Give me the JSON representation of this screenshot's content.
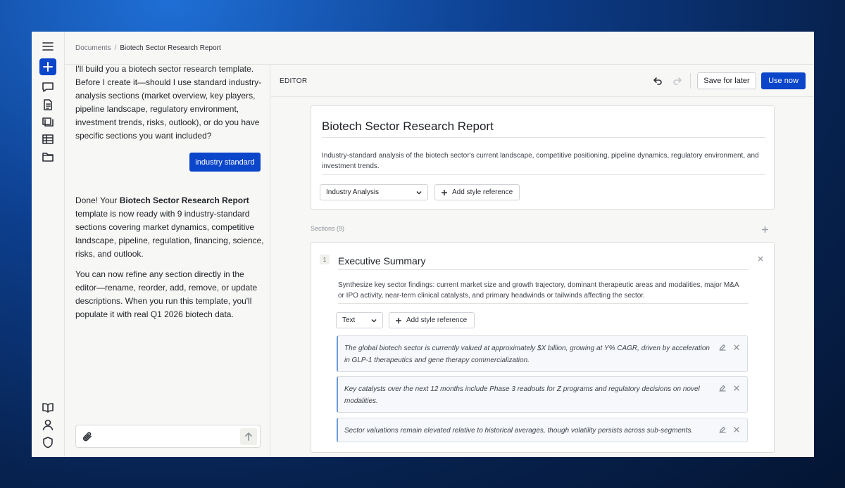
{
  "breadcrumb": {
    "root": "Documents",
    "separator": "/",
    "current": "Biotech Sector Research Report"
  },
  "chat": {
    "assistant_message_lines": [
      "I'll build you a biotech sector research template.",
      "Before I create it—should I use standard industry-",
      "analysis sections (market overview, key players,",
      "pipeline landscape, regulatory environment,",
      "investment trends, risks, outlook), or do you have",
      "specific sections you want included?"
    ],
    "user_reply": "industry standard",
    "done_prefix": "Done! Your ",
    "done_bold": "Biotech Sector Research Report",
    "done_suffix": " template is now ready with 9 industry-standard sections covering market dynamics, competitive landscape, pipeline, regulation, financing, science, risks, and outlook.",
    "followup": "You can now refine any section directly in the editor—rename, reorder, add, remove, or update descriptions. When you run this template, you'll populate it with real Q1 2026 biotech data.",
    "composer_placeholder": ""
  },
  "editor": {
    "label": "EDITOR",
    "save_later": "Save for later",
    "use_now": "Use now",
    "doc_title": "Biotech Sector Research Report",
    "doc_description": "Industry-standard analysis of the biotech sector's current landscape, competitive positioning, pipeline dynamics, regulatory environment, and investment trends.",
    "doc_type": "Industry Analysis",
    "add_style": "Add style reference",
    "sections_label": "Sections (9)",
    "section": {
      "number": "1",
      "title": "Executive Summary",
      "description": "Synthesize key sector findings: current market size and growth trajectory, dominant therapeutic areas and modalities, major M&A or IPO activity, near-term clinical catalysts, and primary headwinds or tailwinds affecting the sector.",
      "format": "Text",
      "add_style": "Add style reference",
      "bullets": [
        "The global biotech sector is currently valued at approximately $X billion, growing at Y% CAGR, driven by acceleration in GLP-1 therapeutics and gene therapy commercialization.",
        "Key catalysts over the next 12 months include Phase 3 readouts for Z programs and regulatory decisions on novel modalities.",
        "Sector valuations remain elevated relative to historical averages, though volatility persists across sub-segments."
      ]
    }
  },
  "icons": [
    "menu-icon",
    "plus-icon",
    "chat-icon",
    "document-icon",
    "layers-icon",
    "table-icon",
    "folder-icon",
    "book-icon",
    "user-icon",
    "shield-icon",
    "paperclip-icon",
    "arrow-up-icon",
    "undo-icon",
    "redo-icon",
    "chevron-down-icon",
    "close-icon",
    "edit-icon"
  ],
  "colors": {
    "accent": "#0b45c9",
    "background": "#f7f7f5",
    "bullet_border": "#6b9bd8"
  }
}
